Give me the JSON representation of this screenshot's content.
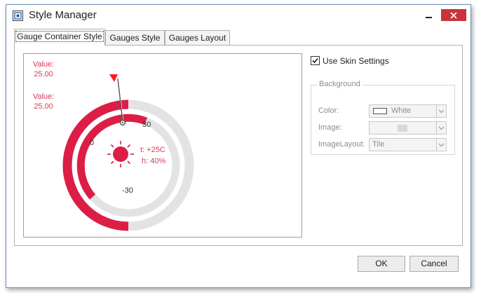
{
  "window": {
    "title": "Style Manager"
  },
  "tabs": [
    {
      "label": "Gauge Container Style",
      "active": true
    },
    {
      "label": "Gauges Style",
      "active": false
    },
    {
      "label": "Gauges Layout",
      "active": false
    }
  ],
  "preview": {
    "value_label_1": "Value:",
    "value_1": "25.00",
    "value_label_2": "Value:",
    "value_2": "25.00",
    "scale_30": "30",
    "scale_0": "0",
    "scale_minus30": "-30",
    "temperature": "t: +25C",
    "humidity": "h: 40%",
    "accent_color": "#dc1e46",
    "track_color": "#e3e3e3"
  },
  "settings": {
    "use_skin_label": "Use Skin Settings",
    "use_skin_checked": true,
    "background_group_title": "Background",
    "color_label": "Color:",
    "color_value": "White",
    "image_label": "Image:",
    "image_layout_label": "ImageLayout:",
    "image_layout_value": "Tile"
  },
  "buttons": {
    "ok": "OK",
    "cancel": "Cancel"
  }
}
